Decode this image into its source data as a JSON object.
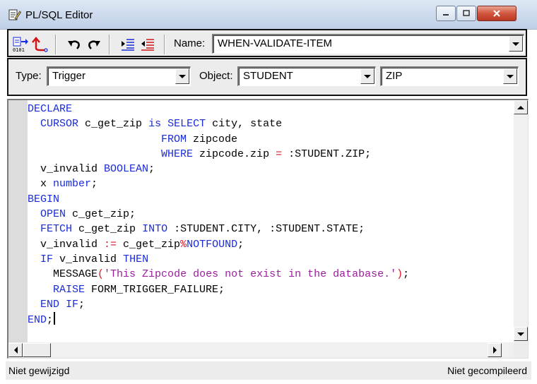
{
  "window": {
    "title": "PL/SQL Editor"
  },
  "toolbar": {
    "name_label": "Name:",
    "name_value": "WHEN-VALIDATE-ITEM",
    "icons": [
      "compile-icon",
      "revert-icon",
      "undo-icon",
      "redo-icon",
      "indent-icon",
      "outdent-icon"
    ]
  },
  "selectors": {
    "type_label": "Type:",
    "type_value": "Trigger",
    "object_label": "Object:",
    "object_value": "STUDENT",
    "item_value": "ZIP"
  },
  "code": {
    "lines": [
      [
        [
          "kw",
          "DECLARE"
        ]
      ],
      [
        [
          "t",
          "  "
        ],
        [
          "kw",
          "CURSOR"
        ],
        [
          "t",
          " c_get_zip "
        ],
        [
          "kw",
          "is"
        ],
        [
          "t",
          " "
        ],
        [
          "kw",
          "SELECT"
        ],
        [
          "t",
          " city, state"
        ]
      ],
      [
        [
          "t",
          "                     "
        ],
        [
          "kw",
          "FROM"
        ],
        [
          "t",
          " zipcode"
        ]
      ],
      [
        [
          "t",
          "                     "
        ],
        [
          "kw",
          "WHERE"
        ],
        [
          "t",
          " zipcode.zip "
        ],
        [
          "op",
          "="
        ],
        [
          "t",
          " :STUDENT.ZIP;"
        ]
      ],
      [
        [
          "t",
          "  v_invalid "
        ],
        [
          "kw",
          "BOOLEAN"
        ],
        [
          "t",
          ";"
        ]
      ],
      [
        [
          "t",
          "  x "
        ],
        [
          "kw",
          "number"
        ],
        [
          "t",
          ";"
        ]
      ],
      [
        [
          "kw",
          "BEGIN"
        ]
      ],
      [
        [
          "t",
          "  "
        ],
        [
          "kw",
          "OPEN"
        ],
        [
          "t",
          " c_get_zip;"
        ]
      ],
      [
        [
          "t",
          "  "
        ],
        [
          "kw",
          "FETCH"
        ],
        [
          "t",
          " c_get_zip "
        ],
        [
          "kw",
          "INTO"
        ],
        [
          "t",
          " :STUDENT.CITY, :STUDENT.STATE;"
        ]
      ],
      [
        [
          "t",
          "  v_invalid "
        ],
        [
          "op",
          ":="
        ],
        [
          "t",
          " c_get_zip"
        ],
        [
          "op",
          "%"
        ],
        [
          "kw",
          "NOTFOUND"
        ],
        [
          "t",
          ";"
        ]
      ],
      [
        [
          "t",
          "  "
        ],
        [
          "kw",
          "IF"
        ],
        [
          "t",
          " v_invalid "
        ],
        [
          "kw",
          "THEN"
        ]
      ],
      [
        [
          "t",
          "    MESSAGE"
        ],
        [
          "op",
          "("
        ],
        [
          "str",
          "'This Zipcode does not exist in the database.'"
        ],
        [
          "op",
          ")"
        ],
        [
          "t",
          ";"
        ]
      ],
      [
        [
          "t",
          "    "
        ],
        [
          "kw",
          "RAISE"
        ],
        [
          "t",
          " FORM_TRIGGER_FAILURE;"
        ]
      ],
      [
        [
          "t",
          "  "
        ],
        [
          "kw",
          "END IF"
        ],
        [
          "t",
          ";"
        ]
      ],
      [
        [
          "kw",
          "END"
        ],
        [
          "t",
          ";"
        ]
      ]
    ]
  },
  "status": {
    "left": "Niet gewijzigd",
    "right": "Niet gecompileerd"
  },
  "colors": {
    "keyword": "#1a2bd8",
    "operator": "#e0162b",
    "string": "#9a1f9a"
  }
}
